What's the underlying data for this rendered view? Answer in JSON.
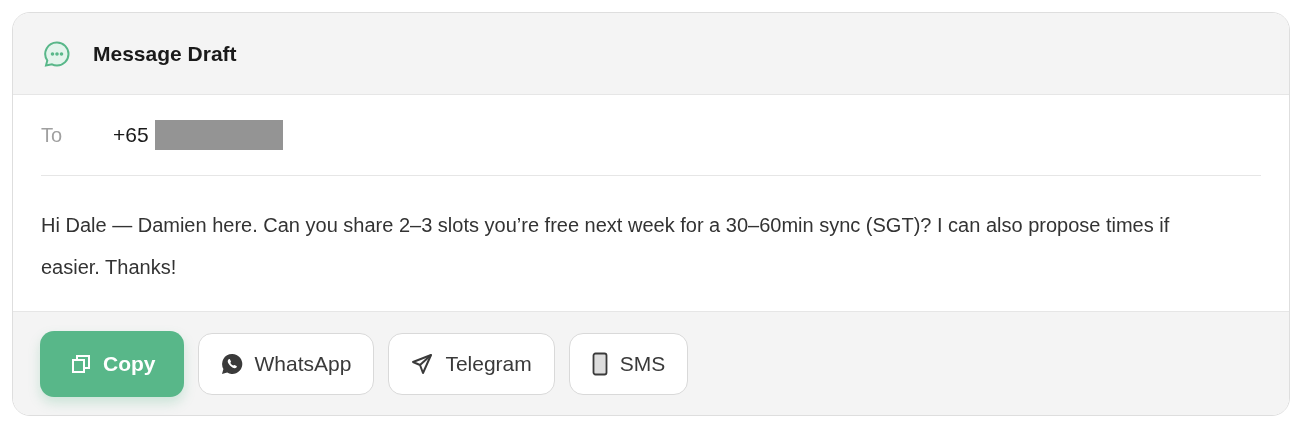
{
  "header": {
    "title": "Message Draft"
  },
  "recipient": {
    "label": "To",
    "value": "+65"
  },
  "message": "Hi Dale — Damien here. Can you share 2–3 slots you’re free next week for a 30–60min sync (SGT)? I can also propose times if easier. Thanks!",
  "buttons": [
    {
      "label": "Copy",
      "kind": "copy"
    },
    {
      "label": "WhatsApp",
      "kind": "whatsapp"
    },
    {
      "label": "Telegram",
      "kind": "telegram"
    },
    {
      "label": "SMS",
      "kind": "sms"
    }
  ]
}
